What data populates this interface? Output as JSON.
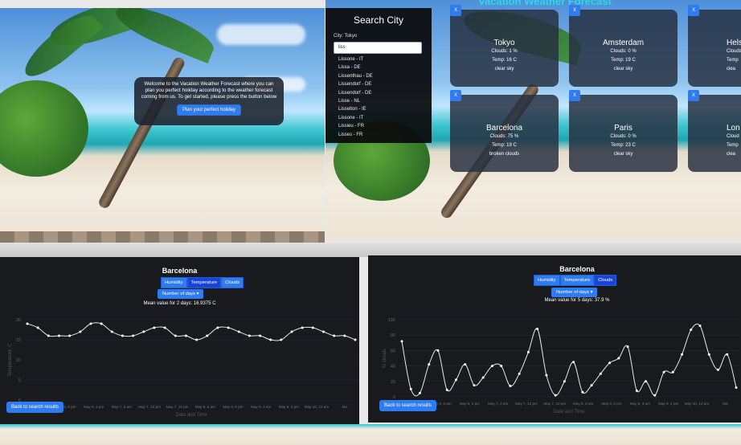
{
  "panel1": {
    "welcome_text": "Welcome to the Vacation Weather Forecast where you can plan you perfect holiday according to the weather forecast coming from us. To get started, please press the button below",
    "plan_button": "Plan your perfect holiday"
  },
  "panel2": {
    "title": "Vacation Weather Forecast",
    "search_title": "Search City",
    "city_label": "City: Tokyo",
    "input_value": "liss",
    "suggestions": [
      "Lissone - IT",
      "Lissa - DE",
      "Lissenthau - DE",
      "Lissendorf - DE",
      "Lissendorf - DE",
      "Lisse - NL",
      "Lisselton - IE",
      "Lissone - IT",
      "Lissieu - FR",
      "Lisses - FR"
    ],
    "remove_label": "X",
    "cards": [
      {
        "city": "Tokyo",
        "clouds": "Clouds: 1 %",
        "temp": "Temp: 16 C",
        "desc": "clear sky"
      },
      {
        "city": "Amsterdam",
        "clouds": "Clouds: 0 %",
        "temp": "Temp: 19 C",
        "desc": "clear sky"
      },
      {
        "city": "Hels",
        "clouds": "Clouds",
        "temp": "Temp",
        "desc": "clea"
      },
      {
        "city": "Barcelona",
        "clouds": "Clouds: 75 %",
        "temp": "Temp: 19 C",
        "desc": "broken clouds"
      },
      {
        "city": "Paris",
        "clouds": "Clouds: 0 %",
        "temp": "Temp: 23 C",
        "desc": "clear sky"
      },
      {
        "city": "Lon",
        "clouds": "Cloud",
        "temp": "Temp",
        "desc": "clea"
      }
    ]
  },
  "chart_view": {
    "tabs": [
      "Humidity",
      "Temperature",
      "Clouds"
    ],
    "days_button": "Number of days",
    "back_button": "Back to search results"
  },
  "panel3": {
    "city": "Barcelona",
    "active_tab": "Temperature",
    "mean_text": "Mean value for 2 days: 16.9375 C"
  },
  "panel4": {
    "city": "Barcelona",
    "active_tab": "Clouds",
    "mean_text": "Mean value for 5 days: 37.9 %"
  },
  "chart_data": [
    {
      "type": "line",
      "title": "Barcelona",
      "xlabel": "Date and Time",
      "ylabel": "Temperature, C",
      "ylim": [
        0,
        20
      ],
      "yticks": [
        0,
        5,
        10,
        15,
        20
      ],
      "tick_labels": [
        "May 6, 4 am",
        "May 6, 6 pm",
        "May 6, 4 pm",
        "May 7, 2 am",
        "May 7, 12 pm",
        "May 7, 10 pm",
        "May 8, 8 am",
        "May 8, 6 pm",
        "May 9, 4 am",
        "May 9, 2 pm",
        "May 10, 12 am",
        "Ma"
      ],
      "series": [
        {
          "values": [
            19,
            18,
            16,
            16,
            16,
            17,
            19,
            19,
            17,
            16,
            16,
            17,
            18,
            18,
            16,
            16,
            15,
            16,
            18,
            18,
            17,
            16,
            16,
            15,
            15,
            17,
            18,
            18,
            17,
            16,
            16,
            15
          ]
        }
      ]
    },
    {
      "type": "line",
      "title": "Barcelona",
      "xlabel": "Date and Time",
      "ylabel": "% clouds",
      "ylim": [
        0,
        100
      ],
      "yticks": [
        0,
        20,
        40,
        60,
        80,
        100
      ],
      "tick_labels": [
        "May 5, 8 pm",
        "May 6, 6 am",
        "May 6, 4 pm",
        "May 7, 2 am",
        "May 7, 12 pm",
        "May 7, 10 pm",
        "May 8, 8 am",
        "May 8, 6 pm",
        "May 9, 4 am",
        "May 9, 2 pm",
        "May 10, 12 am",
        "Ma"
      ],
      "series": [
        {
          "values": [
            72,
            10,
            5,
            42,
            60,
            9,
            22,
            42,
            15,
            25,
            40,
            40,
            14,
            30,
            58,
            88,
            28,
            2,
            20,
            45,
            6,
            15,
            30,
            44,
            50,
            65,
            8,
            20,
            2,
            32,
            32,
            55,
            87,
            92,
            55,
            35,
            55,
            12
          ]
        }
      ]
    }
  ]
}
